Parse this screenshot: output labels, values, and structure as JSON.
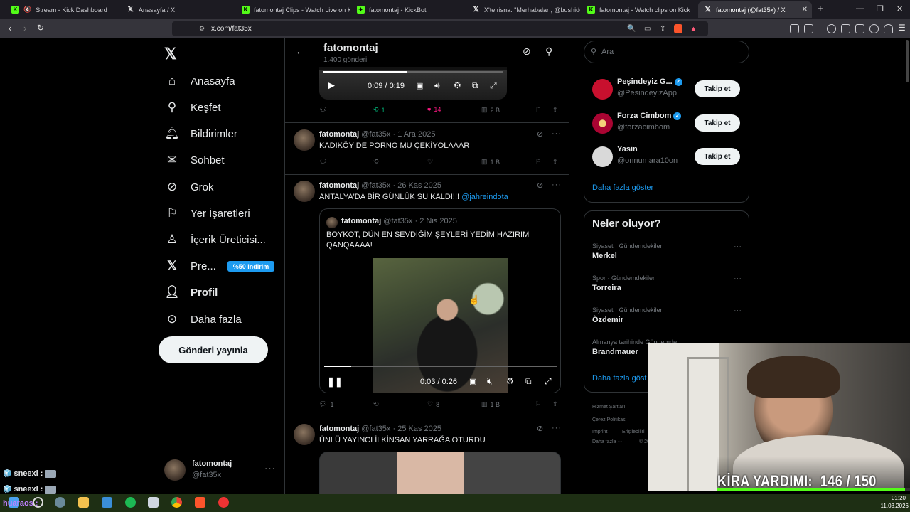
{
  "browser": {
    "tabs": [
      {
        "title": "Stream - Kick Dashboard",
        "icon": "kick-icon"
      },
      {
        "title": "Anasayfa / X",
        "icon": "x-icon"
      },
      {
        "title": "fatomontaj Clips - Watch Live on Kick",
        "icon": "kick-icon"
      },
      {
        "title": "fatomontaj - KickBot",
        "icon": "kickbot-icon"
      },
      {
        "title": "X'te risna: \"Merhabalar , @bushidow",
        "icon": "x-icon"
      },
      {
        "title": "fatomontaj - Watch clips on Kick",
        "icon": "kick-icon"
      },
      {
        "title": "fatomontaj (@fat35x) / X",
        "icon": "x-icon",
        "active": true
      }
    ],
    "url": "x.com/fat35x"
  },
  "nav": {
    "items": [
      {
        "label": "Anasayfa",
        "icon": "home-icon"
      },
      {
        "label": "Keşfet",
        "icon": "search-icon"
      },
      {
        "label": "Bildirimler",
        "icon": "bell-icon"
      },
      {
        "label": "Sohbet",
        "icon": "mail-icon"
      },
      {
        "label": "Grok",
        "icon": "grok-icon"
      },
      {
        "label": "Yer İşaretleri",
        "icon": "bookmark-icon"
      },
      {
        "label": "İçerik Üreticisi...",
        "icon": "creator-icon"
      },
      {
        "label": "Pre...",
        "icon": "x-premium-icon"
      },
      {
        "label": "Profil",
        "icon": "profile-icon"
      },
      {
        "label": "Daha fazla",
        "icon": "more-circle-icon"
      }
    ],
    "premium_badge": "%50 indirim",
    "post_button": "Gönderi yayınla",
    "account": {
      "name": "fatomontaj",
      "handle": "@fat35x"
    }
  },
  "profile_header": {
    "name": "fatomontaj",
    "posts": "1.400 gönderi"
  },
  "tweets": [
    {
      "video": {
        "time": "0:09 / 0:19"
      },
      "stats": {
        "replies": "",
        "retweets": "1",
        "likes": "14",
        "views": "2 B"
      }
    },
    {
      "author": "fatomontaj",
      "handle": "@fat35x",
      "date": "1 Ara 2025",
      "text": "KADIKÖY DE PORNO MU ÇEKİYOLAAAR",
      "stats": {
        "replies": "",
        "retweets": "",
        "likes": "",
        "views": "1 B"
      }
    },
    {
      "author": "fatomontaj",
      "handle": "@fat35x",
      "date": "26 Kas 2025",
      "text": "ANTALYA'DA BİR GÜNLÜK SU KALDI!!!",
      "mention": "@jahreindota",
      "quote": {
        "author": "fatomontaj",
        "handle": "@fat35x",
        "date": "2 Nis 2025",
        "text_line1": "BOYKOT, DÜN EN SEVDİĞİM ŞEYLERİ YEDİM HAZIRIM",
        "text_line2": "QANQAAAA!",
        "video_time": "0:03 / 0:26"
      },
      "stats": {
        "replies": "1",
        "retweets": "",
        "likes": "8",
        "views": "1 B"
      }
    },
    {
      "author": "fatomontaj",
      "handle": "@fat35x",
      "date": "25 Kas 2025",
      "text": "ÜNLÜ YAYINCI İLKİNSAN YARRAĞA OTURDU"
    }
  ],
  "right": {
    "search_placeholder": "Ara",
    "suggestions": [
      {
        "name": "Peşindeyiz G...",
        "handle": "@PesindeyizApp",
        "verified": true,
        "button": "Takip et",
        "color": "#c8102e"
      },
      {
        "name": "Forza Cimbom",
        "handle": "@forzacimbom",
        "verified": true,
        "button": "Takip et",
        "color": "#a90432"
      },
      {
        "name": "Yasin",
        "handle": "@onnumara10on",
        "verified": false,
        "button": "Takip et",
        "color": "#d9d9d9"
      }
    ],
    "show_more": "Daha fazla göster",
    "trends_title": "Neler oluyor?",
    "trends": [
      {
        "category": "Siyaset · Gündemdekiler",
        "title": "Merkel"
      },
      {
        "category": "Spor · Gündemdekiler",
        "title": "Torreira"
      },
      {
        "category": "Siyaset · Gündemdekiler",
        "title": "Özdemir"
      },
      {
        "category": "Almanya tarihinde Gündemde",
        "title": "Brandmauer"
      }
    ],
    "trends_more": "Daha fazla göst",
    "footer": [
      "Hizmet Şartları",
      "Çerez Politikası",
      "Imprint",
      "Erişilebilirl",
      "Daha fazla ···",
      "© 20"
    ]
  },
  "overlay": {
    "donation_label": "KİRA YARDIMI:",
    "donation_value": "146 / 150",
    "donation_progress": 0.973,
    "chat": [
      {
        "user": "sneexl :"
      },
      {
        "user": "sneexl :"
      },
      {
        "user": "huaraos :"
      }
    ]
  },
  "taskbar": {
    "time": "01:20",
    "date": "11.03.2026"
  }
}
